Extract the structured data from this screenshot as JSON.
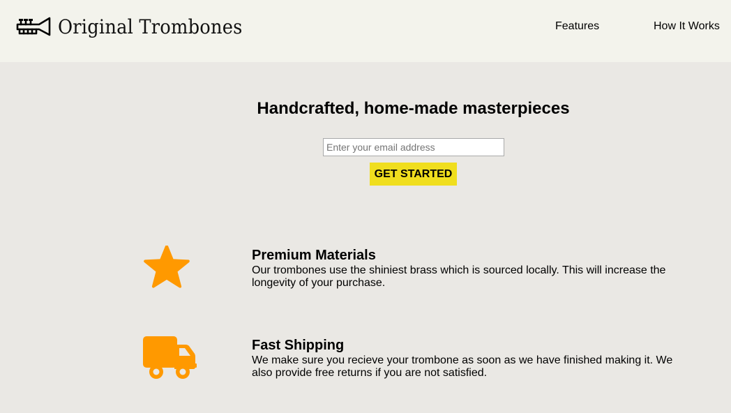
{
  "header": {
    "logo_text": "Original Trombones",
    "logo_icon": "trumpet-icon",
    "nav": [
      {
        "label": "Features"
      },
      {
        "label": "How It Works"
      }
    ]
  },
  "hero": {
    "title": "Handcrafted, home-made masterpieces",
    "email_placeholder": "Enter your email address",
    "email_value": "",
    "cta_label": "GET STARTED"
  },
  "features": [
    {
      "icon": "star-icon",
      "title": "Premium Materials",
      "description": "Our trombones use the shiniest brass which is sourced locally. This will increase the longevity of your purchase."
    },
    {
      "icon": "truck-icon",
      "title": "Fast Shipping",
      "description": "We make sure you recieve your trombone as soon as we have finished making it. We also provide free returns if you are not satisfied."
    }
  ],
  "colors": {
    "header_bg": "#f3f3ec",
    "page_bg": "#eae8e4",
    "cta_bg": "#f0de1e",
    "icon_accent": "#ff9900"
  }
}
